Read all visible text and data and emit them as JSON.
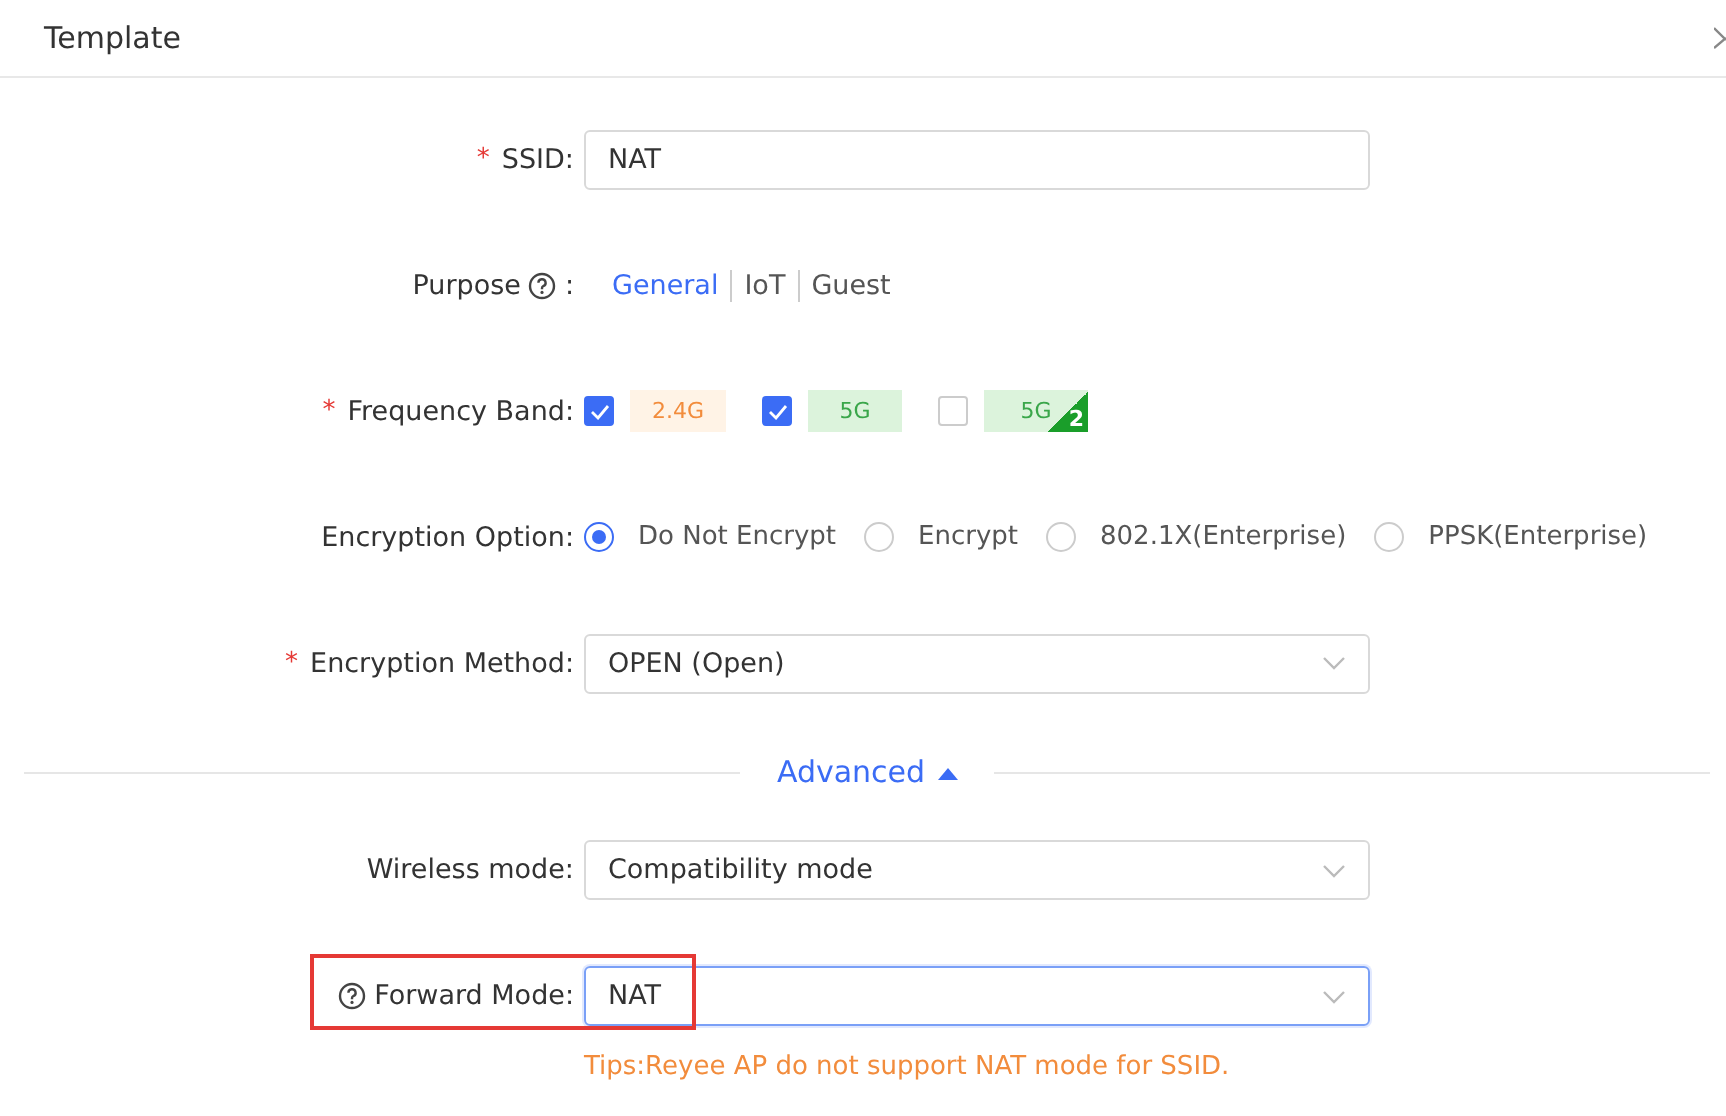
{
  "dialog": {
    "title": "Template"
  },
  "fields": [
    {
      "kind": "text",
      "label": "SSID:",
      "required_mark": "*",
      "value": "NAT"
    },
    {
      "kind": "segmented",
      "label": "Purpose",
      "help": true,
      "colon": ":",
      "options": [
        {
          "label": "General",
          "selected": true
        },
        {
          "label": "IoT",
          "selected": false
        },
        {
          "label": "Guest",
          "selected": false
        }
      ]
    },
    {
      "kind": "bands",
      "label": "Frequency Band:",
      "required_mark": "*",
      "options": [
        {
          "label": "2.4G",
          "checked": true,
          "color": "#f28c3c"
        },
        {
          "label": "5G",
          "checked": true,
          "color": "#3aa64a"
        },
        {
          "label": "5G",
          "checked": false,
          "color": "#3aa64a",
          "badge": "2"
        }
      ]
    },
    {
      "kind": "radio",
      "label": "Encryption Option:",
      "options": [
        {
          "label": "Do Not Encrypt",
          "selected": true
        },
        {
          "label": "Encrypt",
          "selected": false
        },
        {
          "label": "802.1X(Enterprise)",
          "selected": false
        },
        {
          "label": "PPSK(Enterprise)",
          "selected": false
        }
      ]
    },
    {
      "kind": "select",
      "label": "Encryption Method:",
      "required_mark": "*",
      "value": "OPEN (Open)",
      "focused": false
    }
  ],
  "advanced": {
    "label": "Advanced",
    "expanded": true
  },
  "advanced_fields": [
    {
      "kind": "select",
      "label": "Wireless mode:",
      "value": "Compatibility mode",
      "focused": false
    },
    {
      "kind": "select",
      "label": "Forward Mode:",
      "help": true,
      "help_before": true,
      "value": "NAT",
      "focused": true,
      "highlighted": true
    }
  ],
  "tip": "Tips:Reyee AP do not support NAT mode for SSID."
}
